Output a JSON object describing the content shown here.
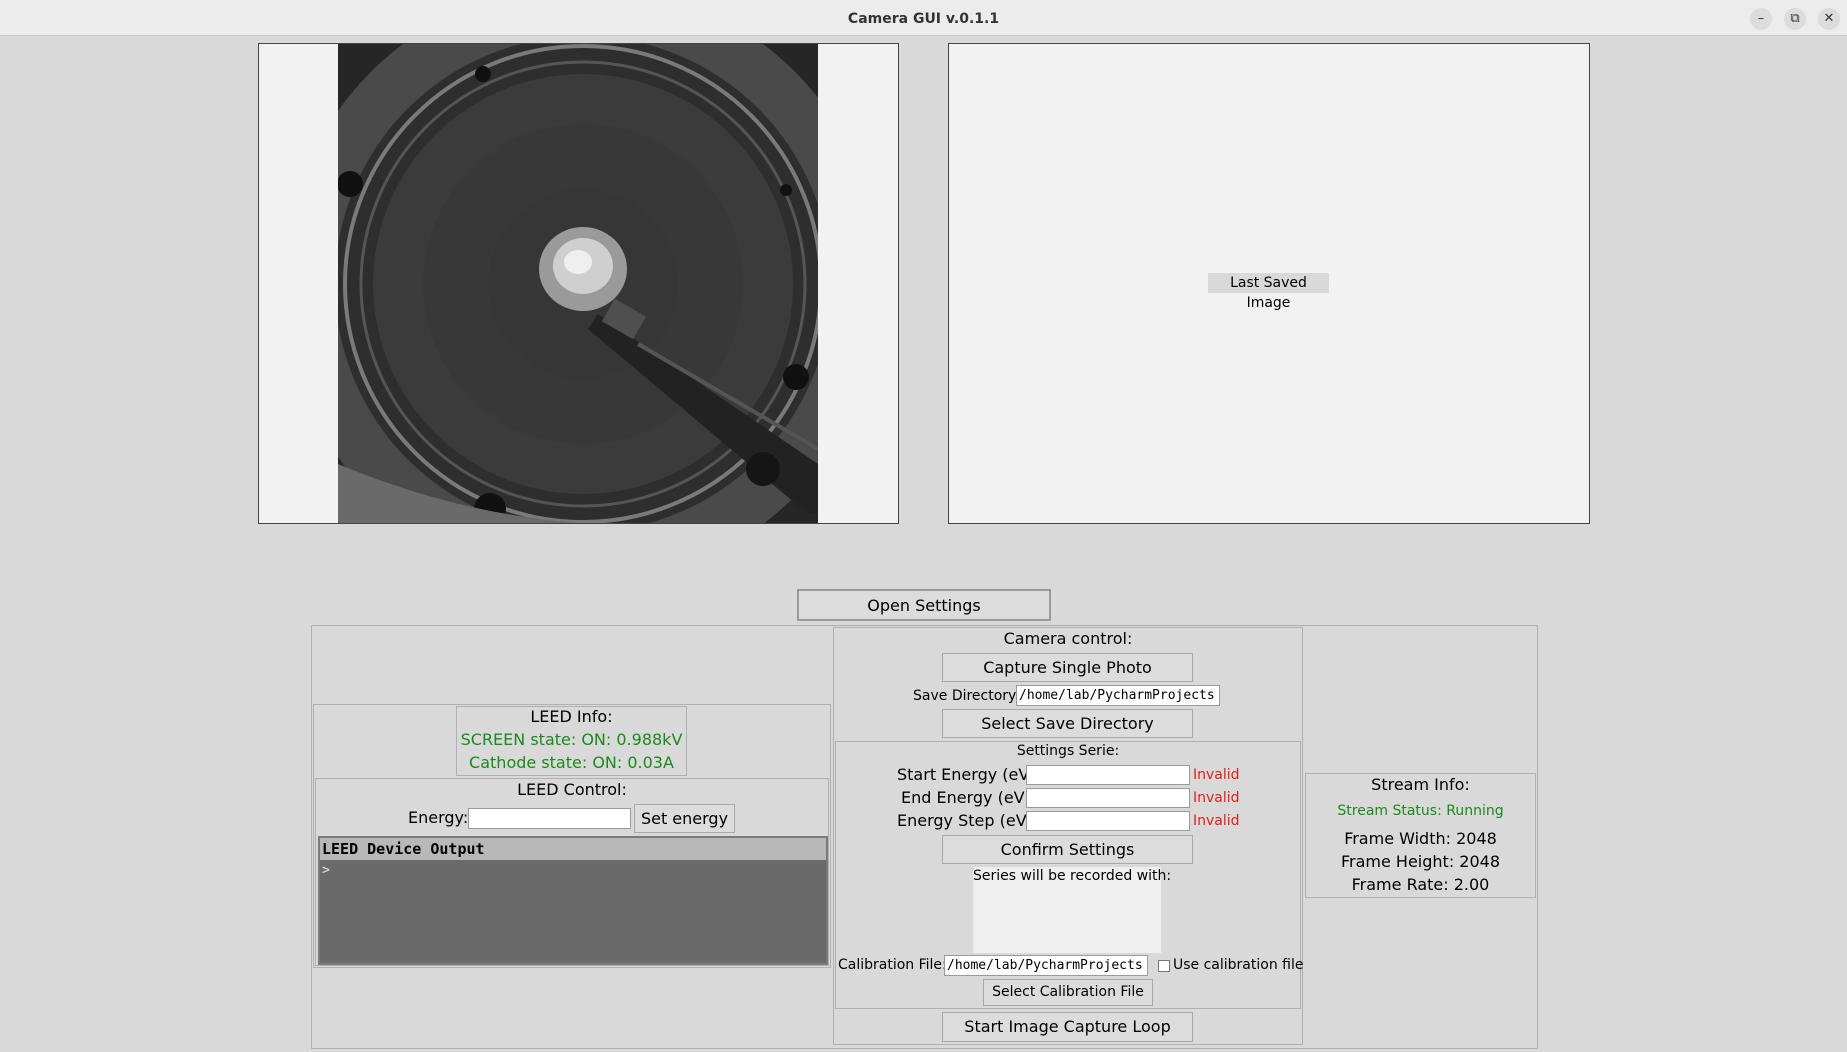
{
  "window": {
    "title": "Camera GUI v.0.1.1",
    "minimize": "–",
    "restore": "⧉",
    "close": "✕"
  },
  "last_saved": {
    "label": "Last Saved Image"
  },
  "open_settings": "Open Settings",
  "leed_info": {
    "title": "LEED Info:",
    "screen_state": "SCREEN state: ON: 0.988kV",
    "cathode_state": "Cathode state: ON: 0.03A",
    "status_color": "#1a8a1a"
  },
  "leed_control": {
    "title": "LEED Control:",
    "energy_label": "Energy:",
    "energy_value": "",
    "set_energy": "Set energy",
    "output_title": "LEED Device Output",
    "output_prompt": ">"
  },
  "camera_control": {
    "title": "Camera control:",
    "capture": "Capture Single Photo",
    "save_dir_label": "Save Directory:",
    "save_dir_value": "/home/lab/PycharmProjects",
    "select_save_dir": "Select Save Directory"
  },
  "settings_serie": {
    "title": "Settings Serie:",
    "fields": [
      {
        "label": "Start Energy (eV):",
        "value": "",
        "status": "Invalid"
      },
      {
        "label": "End Energy (eV):",
        "value": "",
        "status": "Invalid"
      },
      {
        "label": "Energy Step (eV):",
        "value": "",
        "status": "Invalid"
      }
    ],
    "confirm": "Confirm Settings",
    "series_label": "Series will be recorded with:",
    "calib_label": "Calibration File:",
    "calib_value": "/home/lab/PycharmProjects",
    "use_calib": "Use calibration file",
    "use_calib_checked": false,
    "select_calib": "Select Calibration File",
    "invalid_color": "#e0201a"
  },
  "start_loop": "Start Image Capture Loop",
  "stream_info": {
    "title": "Stream Info:",
    "status": "Stream Status: Running",
    "width": "Frame Width: 2048",
    "height": "Frame Height: 2048",
    "rate": "Frame Rate: 2.00"
  }
}
